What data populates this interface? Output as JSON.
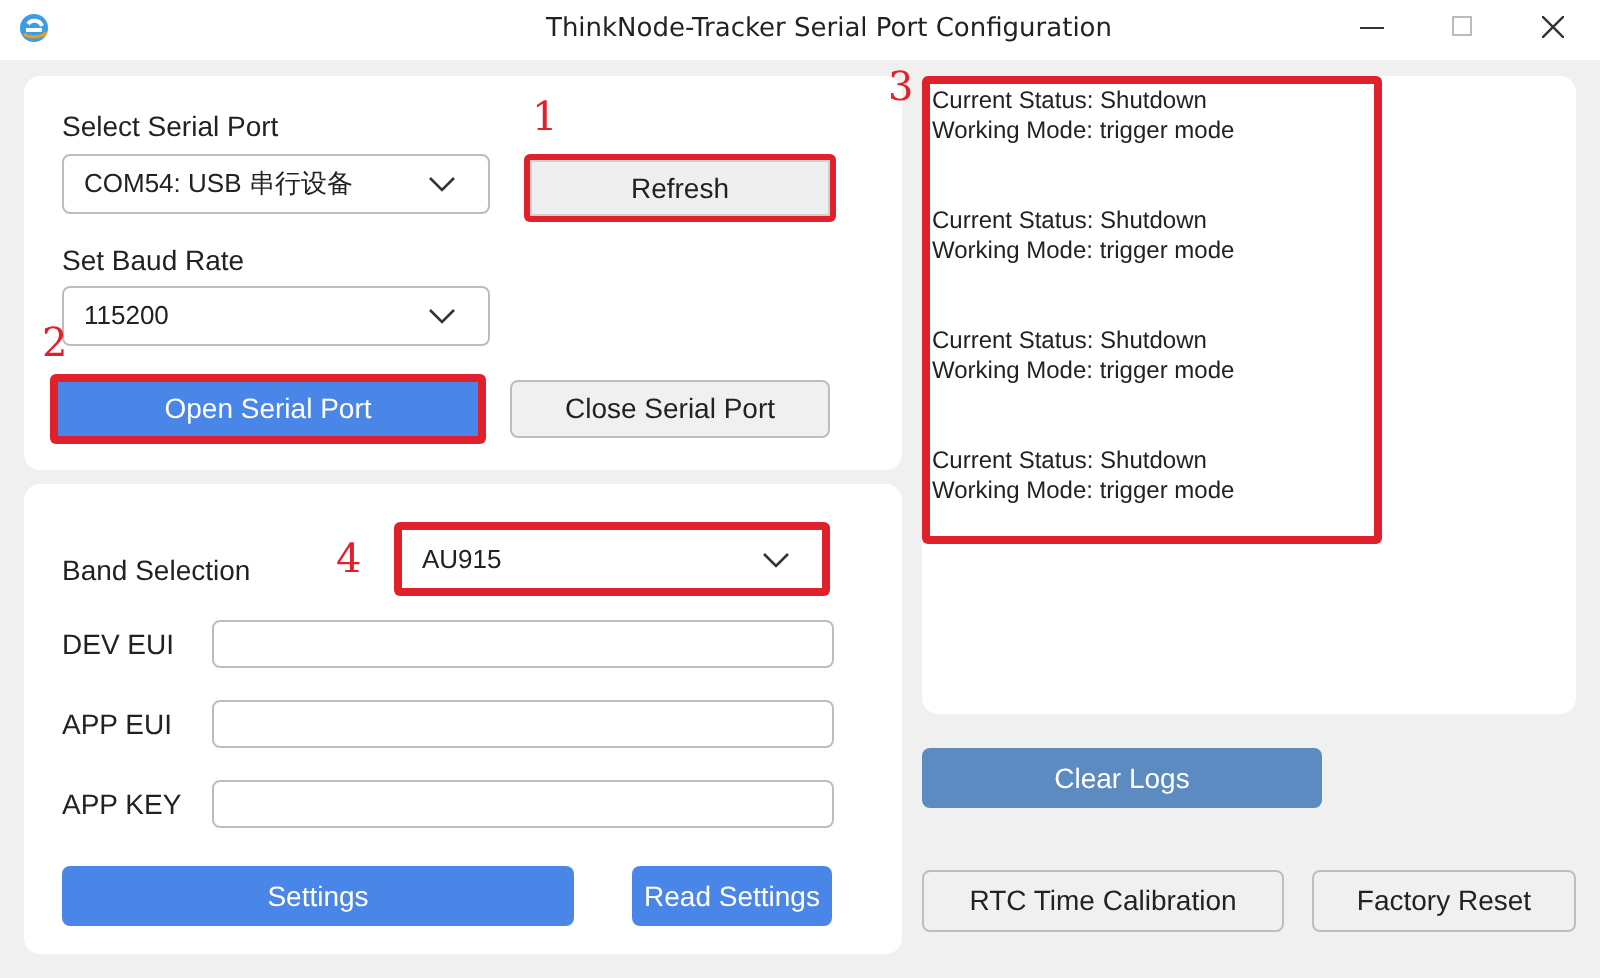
{
  "window": {
    "title": "ThinkNode-Tracker Serial Port Configuration"
  },
  "serial": {
    "port_label": "Select Serial Port",
    "port_value": "COM54: USB 串行设备",
    "refresh": {
      "label": "Refresh",
      "annotation": "1"
    },
    "baud_label": "Set Baud Rate",
    "baud_value": "115200",
    "open": {
      "label": "Open Serial Port",
      "annotation": "2"
    },
    "close": {
      "label": "Close Serial Port"
    }
  },
  "lora": {
    "band_label": "Band Selection",
    "band_value": "AU915",
    "band_annotation": "4",
    "fields": [
      {
        "label": "DEV EUI"
      },
      {
        "label": "APP EUI"
      },
      {
        "label": "APP KEY"
      }
    ],
    "settings": "Settings",
    "read_settings": "Read Settings"
  },
  "log": {
    "annotation": "3",
    "entries": [
      {
        "status": "Current Status: Shutdown",
        "mode": "Working Mode: trigger mode"
      },
      {
        "status": "Current Status: Shutdown",
        "mode": "Working Mode: trigger mode"
      },
      {
        "status": "Current Status: Shutdown",
        "mode": "Working Mode: trigger mode"
      },
      {
        "status": "Current Status: Shutdown",
        "mode": "Working Mode: trigger mode"
      }
    ]
  },
  "clear_logs": "Clear Logs",
  "rtc": "RTC Time Calibration",
  "factory_reset": "Factory Reset"
}
